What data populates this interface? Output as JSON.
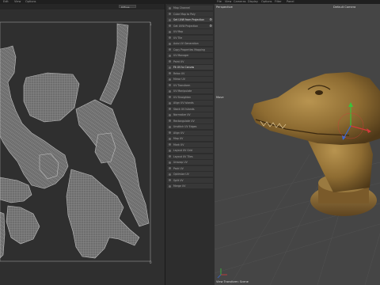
{
  "menubar": {
    "left_items": [
      "Edit",
      "View",
      "Options"
    ],
    "right_items": [
      "File",
      "View",
      "Cameras",
      "Display",
      "Options",
      "Filter",
      "Panel"
    ]
  },
  "uv_editor": {
    "channel_dropdown": "Diffuse"
  },
  "command_panel": {
    "items": [
      {
        "label": "Map Channel",
        "highlight": false
      },
      {
        "label": "Cube Map to Poly",
        "highlight": false
      },
      {
        "label": "Set UVW from Projection",
        "highlight": true,
        "gear": true
      },
      {
        "label": "Get UVW Projection",
        "highlight": false,
        "gear": true
      },
      {
        "label": "UV Map",
        "highlight": false
      },
      {
        "label": "UV Tile",
        "highlight": false
      },
      {
        "label": "Auto UV Generation",
        "highlight": false
      },
      {
        "label": "Copy Properties Mapping",
        "highlight": false
      },
      {
        "label": "UV Manager",
        "highlight": false
      },
      {
        "label": "Paint UV",
        "highlight": false
      },
      {
        "label": "Fit UV to Canvas",
        "highlight": true
      },
      {
        "label": "Relax UV",
        "highlight": false
      },
      {
        "label": "Mirror UV",
        "highlight": false
      },
      {
        "label": "UV Transform",
        "highlight": false
      },
      {
        "label": "UV Manipulate",
        "highlight": false
      },
      {
        "label": "UV Straighten",
        "highlight": false
      },
      {
        "label": "Align UV Islands",
        "highlight": false
      },
      {
        "label": "Stack UV Islands",
        "highlight": false
      },
      {
        "label": "Normalize UV",
        "highlight": false
      },
      {
        "label": "Rectangulate UV",
        "highlight": false
      },
      {
        "label": "Unstitch UV Edges",
        "highlight": false
      },
      {
        "label": "Align UV",
        "highlight": false
      },
      {
        "label": "Map UV",
        "highlight": false
      },
      {
        "label": "Mark UV",
        "highlight": false
      },
      {
        "label": "Layout UV Grid",
        "highlight": false
      },
      {
        "label": "Layout UV Tiles",
        "highlight": false
      },
      {
        "label": "Unwrap UV",
        "highlight": false
      },
      {
        "label": "Pack UV",
        "highlight": false
      },
      {
        "label": "Optimize UV",
        "highlight": false
      },
      {
        "label": "Split UV",
        "highlight": false
      },
      {
        "label": "Merge UV",
        "highlight": false
      }
    ]
  },
  "viewport": {
    "view_name": "Perspective",
    "camera_name": "Default Camera",
    "tool_label": "Move",
    "status_text": "View Transform: Scene"
  },
  "colors": {
    "uv_mesh": "#7a7a7a",
    "uv_mesh_line": "#b8b8b8",
    "model_body": "#9a7a40",
    "model_dark": "#5a4020",
    "axis_x": "#d23a3a",
    "axis_y": "#3ac23a",
    "axis_z": "#3a6ad2"
  },
  "icons": [
    "gear-icon",
    "move-gizmo-icon",
    "axis-icon"
  ]
}
